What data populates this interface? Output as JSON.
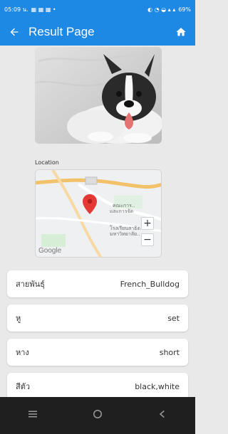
{
  "status_bar": {
    "time": "05:09 น.",
    "battery": "69%"
  },
  "appbar": {
    "title": "Result Page"
  },
  "location": {
    "label": "Location",
    "map_labels": [
      "คณะการ..",
      "และการจัด",
      "โรงเรียนสาธิต",
      "มหาวิทยาลัย.."
    ]
  },
  "map": {
    "brand": "Google"
  },
  "details": [
    {
      "label": "สายพันธุ์",
      "value": "French_Bulldog"
    },
    {
      "label": "หู",
      "value": "set"
    },
    {
      "label": "หาง",
      "value": "short"
    },
    {
      "label": "สีตัว",
      "value": "black,white"
    }
  ],
  "icons": {
    "back": "arrow-back-icon",
    "home": "home-icon",
    "map_pin": "map-pin-icon",
    "nav": [
      "menu-icon",
      "home-circle-icon",
      "back-triangle-icon"
    ]
  },
  "colors": {
    "primary": "#1e88e5",
    "pin": "#e53935"
  }
}
